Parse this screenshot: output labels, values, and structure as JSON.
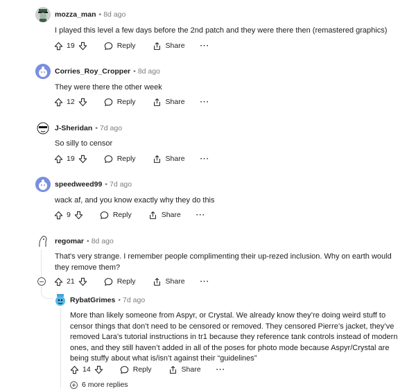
{
  "comments": [
    {
      "user": "mozza_man",
      "time": "8d ago",
      "body": "I played this level a few days before the 2nd patch and they were there then (remastered graphics)",
      "votes": "19"
    },
    {
      "user": "Corries_Roy_Cropper",
      "time": "8d ago",
      "body": "They were there the other week",
      "votes": "12"
    },
    {
      "user": "J-Sheridan",
      "time": "7d ago",
      "body": "So silly to censor",
      "votes": "19"
    },
    {
      "user": "speedweed99",
      "time": "7d ago",
      "body": "wack af, and you know exactly why they do this",
      "votes": "9"
    },
    {
      "user": "regomar",
      "time": "8d ago",
      "body": "That's very strange. I remember people complimenting their up-rezed inclusion. Why on earth would they remove them?",
      "votes": "21"
    },
    {
      "user": "RybatGrimes",
      "time": "7d ago",
      "body": "More than likely someone from Aspyr, or Crystal. We already know they’re doing weird stuff to censor things that don’t need to be censored or removed. They censored Pierre’s jacket, they’ve removed Lara’s tutorial instructions in tr1 because they reference tank controls instead of modern ones, and they still haven’t added in all of the poses for photo mode because Aspyr/Crystal are being stuffy about what is/isn’t against their “guidelines”",
      "votes": "14"
    }
  ],
  "labels": {
    "reply": "Reply",
    "share": "Share",
    "more": "···",
    "dot": "•",
    "more_replies": "6 more replies"
  },
  "icons": {
    "upvote": "upvote-arrow-icon",
    "downvote": "downvote-arrow-icon",
    "reply": "speech-bubble-icon",
    "share": "share-icon"
  },
  "colors": {
    "text": "#1c1c1c",
    "meta": "#7c7c7c",
    "line": "#e5e5e5",
    "avatar_blue": "#7a8fe0"
  }
}
